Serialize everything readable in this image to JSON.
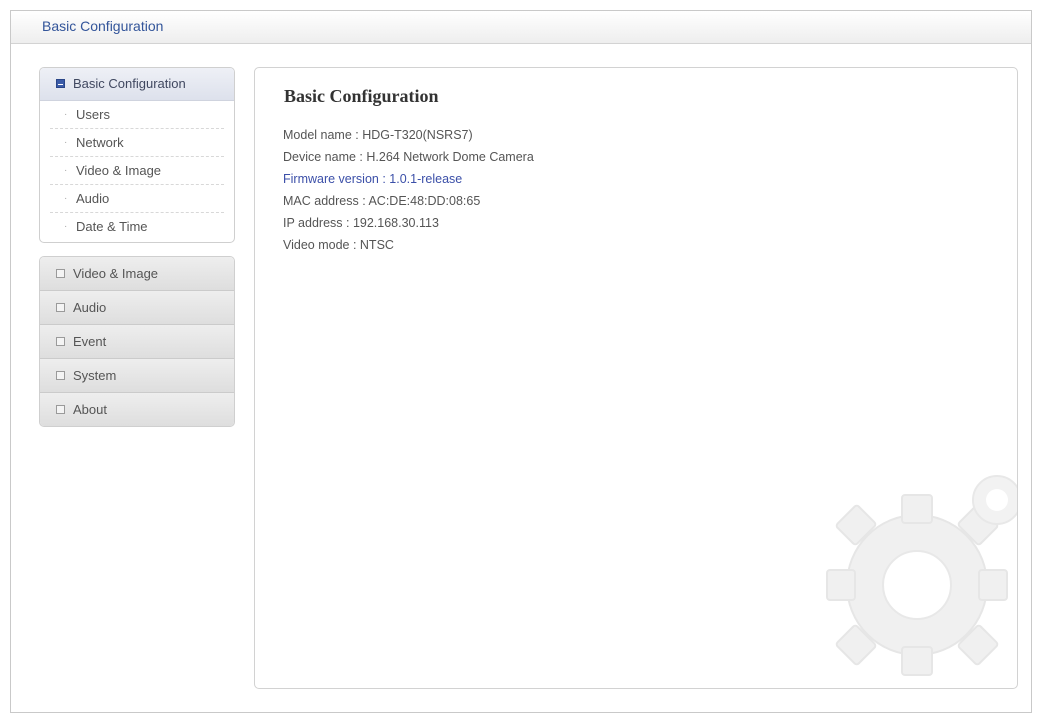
{
  "header": {
    "title": "Basic Configuration"
  },
  "sidebar": {
    "submenu": {
      "title": "Basic Configuration",
      "icon": "collapse-square-icon",
      "items": [
        {
          "label": "Users"
        },
        {
          "label": "Network"
        },
        {
          "label": "Video & Image"
        },
        {
          "label": "Audio"
        },
        {
          "label": "Date & Time"
        }
      ]
    },
    "menu": [
      {
        "label": "Video & Image",
        "icon": "expand-square-icon"
      },
      {
        "label": "Audio",
        "icon": "expand-square-icon"
      },
      {
        "label": "Event",
        "icon": "expand-square-icon"
      },
      {
        "label": "System",
        "icon": "expand-square-icon"
      },
      {
        "label": "About",
        "icon": "expand-square-icon"
      }
    ]
  },
  "main": {
    "title": "Basic Configuration",
    "info": [
      {
        "text": "Model name : HDG-T320(NSRS7)"
      },
      {
        "text": "Device name : H.264 Network Dome Camera"
      },
      {
        "text": "Firmware version : 1.0.1-release"
      },
      {
        "text": "MAC address : AC:DE:48:DD:08:65"
      },
      {
        "text": "IP address : 192.168.30.113"
      },
      {
        "text": "Video mode : NTSC"
      }
    ],
    "watermark_icon": "gear-icon"
  },
  "colors": {
    "accent": "#3b5ba8",
    "title_text": "#33559a",
    "link_text": "#3b4fa8"
  }
}
